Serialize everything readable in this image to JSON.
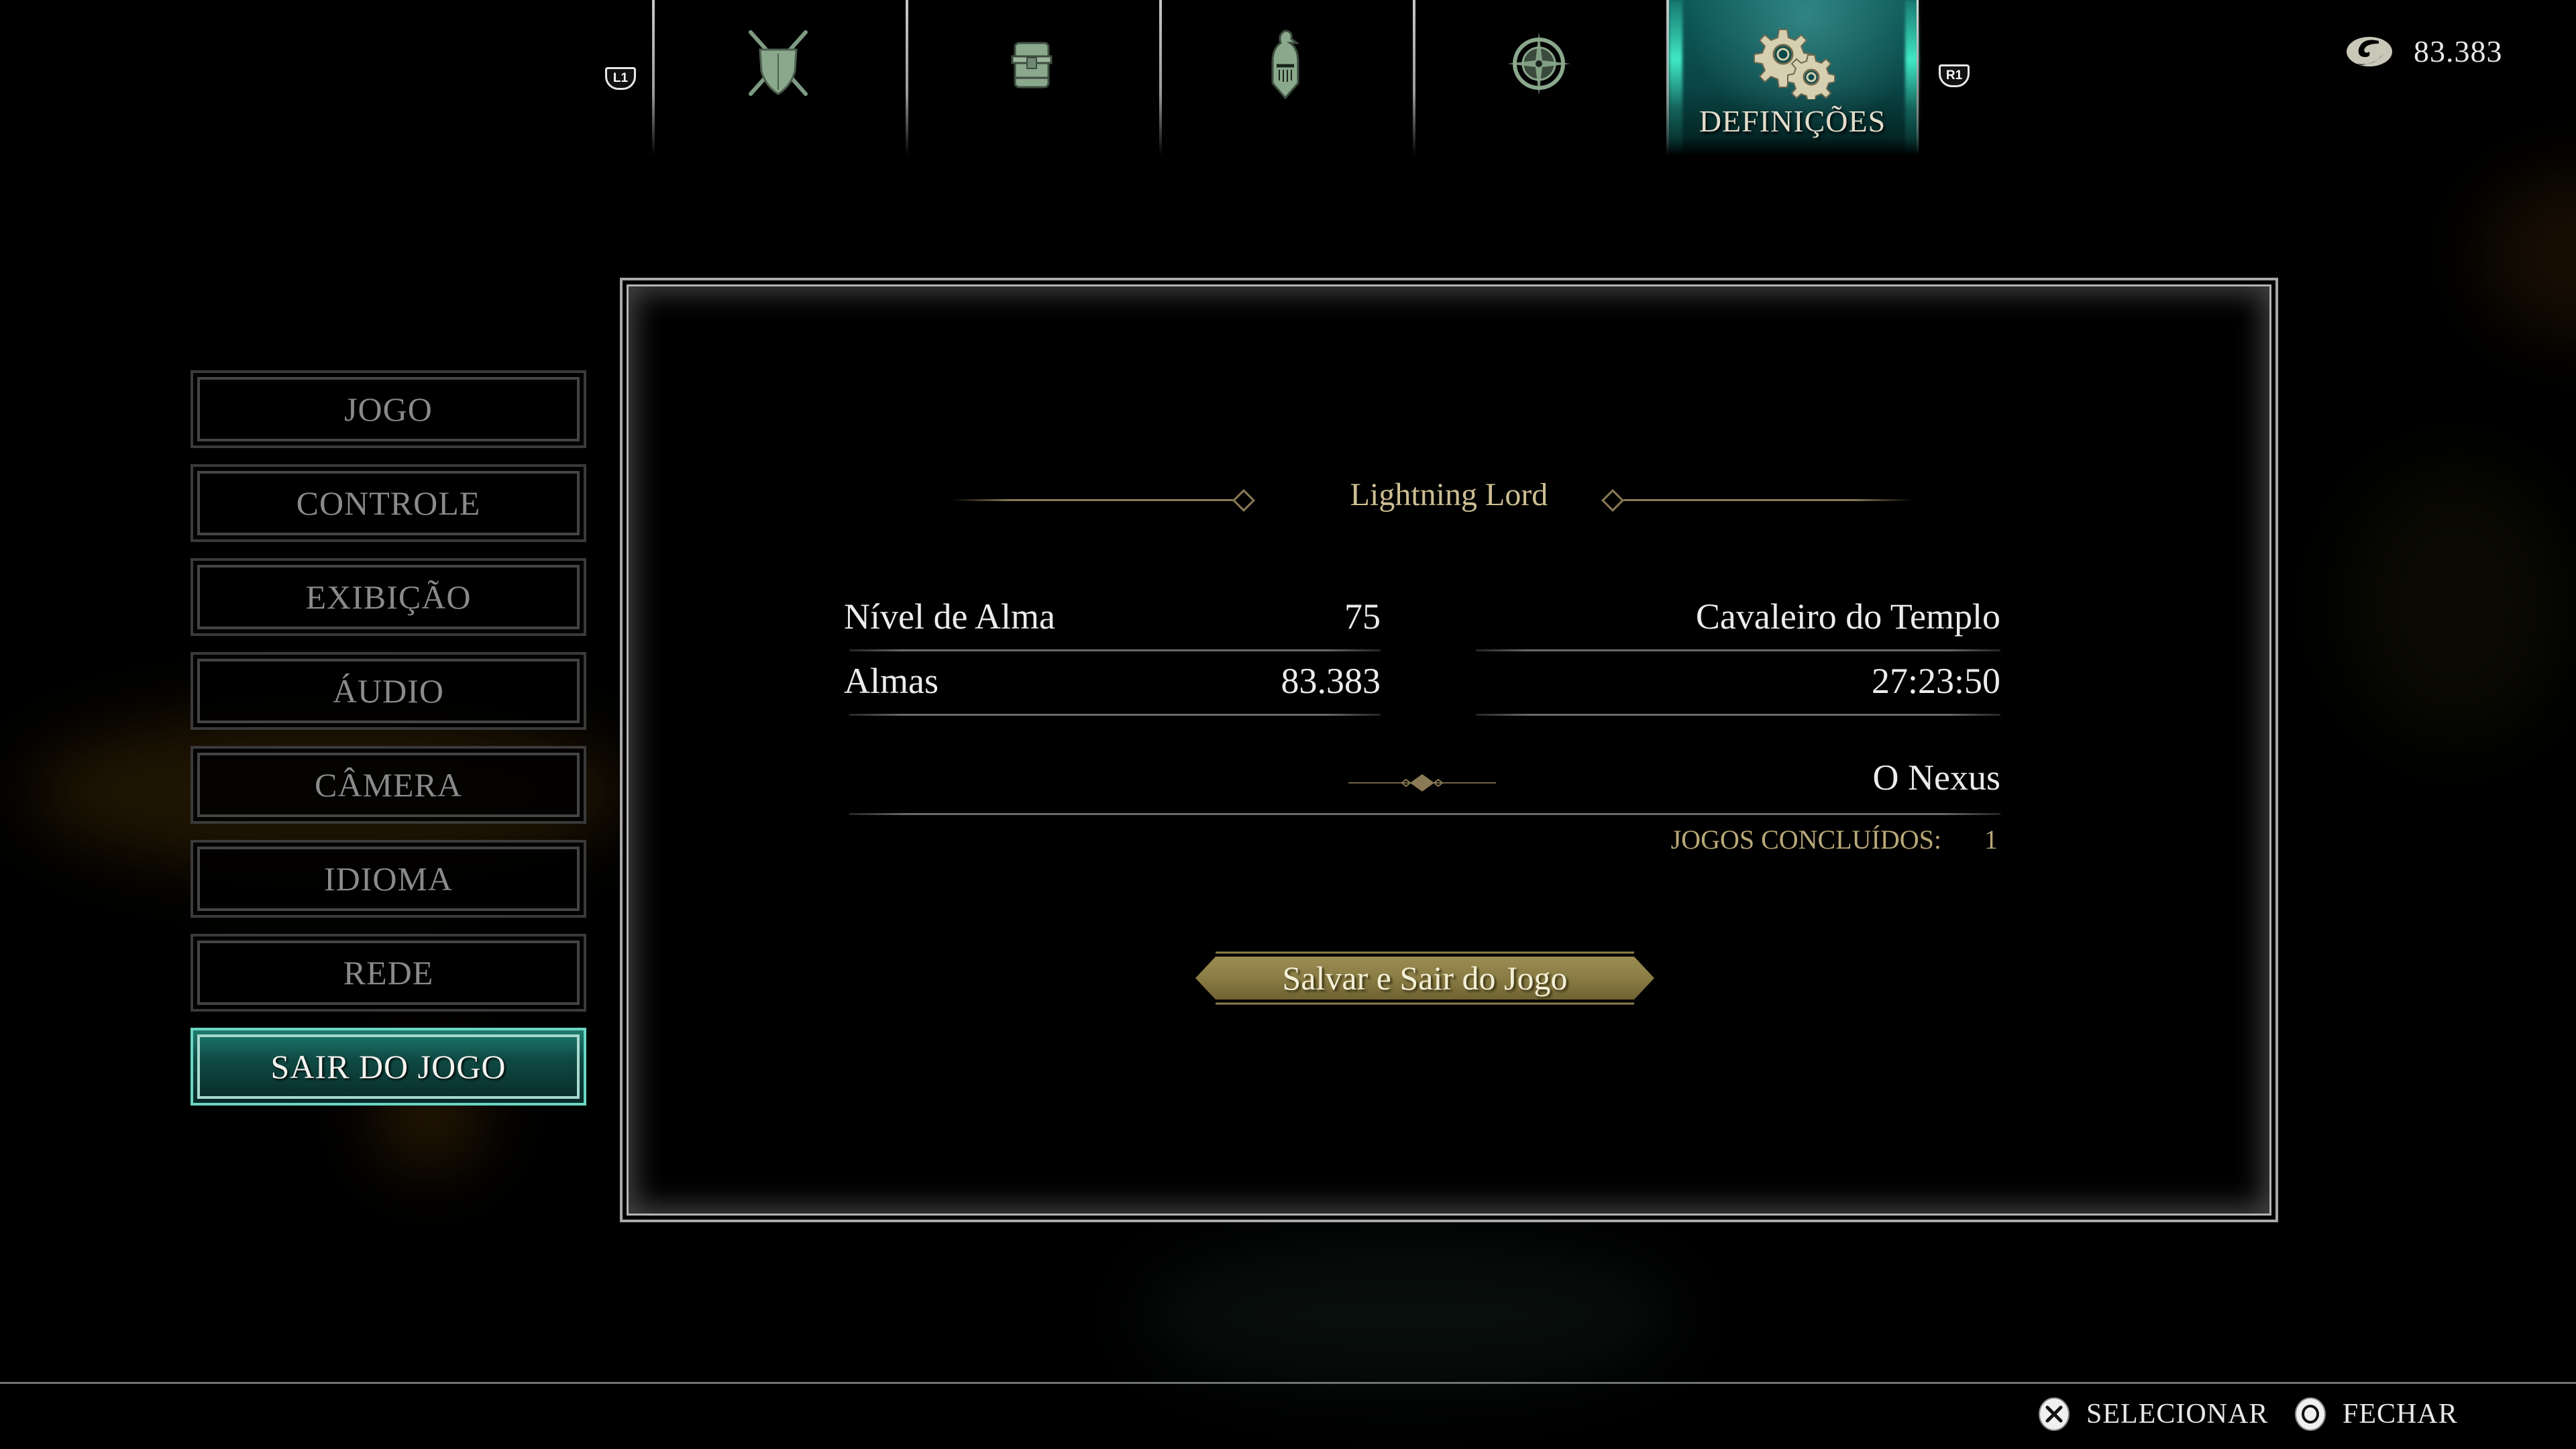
{
  "top_nav": {
    "left_shoulder": "L1",
    "right_shoulder": "R1",
    "tabs": [
      {
        "icon": "crossed-swords-shield-icon",
        "label": ""
      },
      {
        "icon": "treasure-chest-icon",
        "label": ""
      },
      {
        "icon": "knight-helmet-icon",
        "label": ""
      },
      {
        "icon": "compass-rose-icon",
        "label": ""
      },
      {
        "icon": "gears-icon",
        "label": "DEFINIÇÕES",
        "active": true
      }
    ],
    "currency": {
      "icon": "soul-icon",
      "value": "83.383"
    }
  },
  "settings_menu": {
    "items": [
      {
        "label": "JOGO"
      },
      {
        "label": "CONTROLE"
      },
      {
        "label": "EXIBIÇÃO"
      },
      {
        "label": "ÁUDIO"
      },
      {
        "label": "CÂMERA"
      },
      {
        "label": "IDIOMA"
      },
      {
        "label": "REDE"
      },
      {
        "label": "SAIR DO JOGO",
        "active": true
      }
    ]
  },
  "character_panel": {
    "name": "Lightning Lord",
    "soul_level_label": "Nível de Alma",
    "soul_level_value": "75",
    "souls_label": "Almas",
    "souls_value": "83.383",
    "class": "Cavaleiro do Templo",
    "play_time": "27:23:50",
    "location": "O Nexus",
    "new_game_label": "JOGOS CONCLUÍDOS:",
    "new_game_value": "1",
    "save_quit_button": "Salvar e Sair do Jogo"
  },
  "footer": {
    "select": {
      "icon": "cross-button-icon",
      "label": "SELECIONAR"
    },
    "close": {
      "icon": "circle-button-icon",
      "label": "FECHAR"
    }
  },
  "colors": {
    "accent_teal": "#0f4a44",
    "highlight_teal": "#6ad6c2",
    "gold": "#cdbf93",
    "gold_dim": "#b9a878",
    "button_gold": "#8c7e48"
  }
}
